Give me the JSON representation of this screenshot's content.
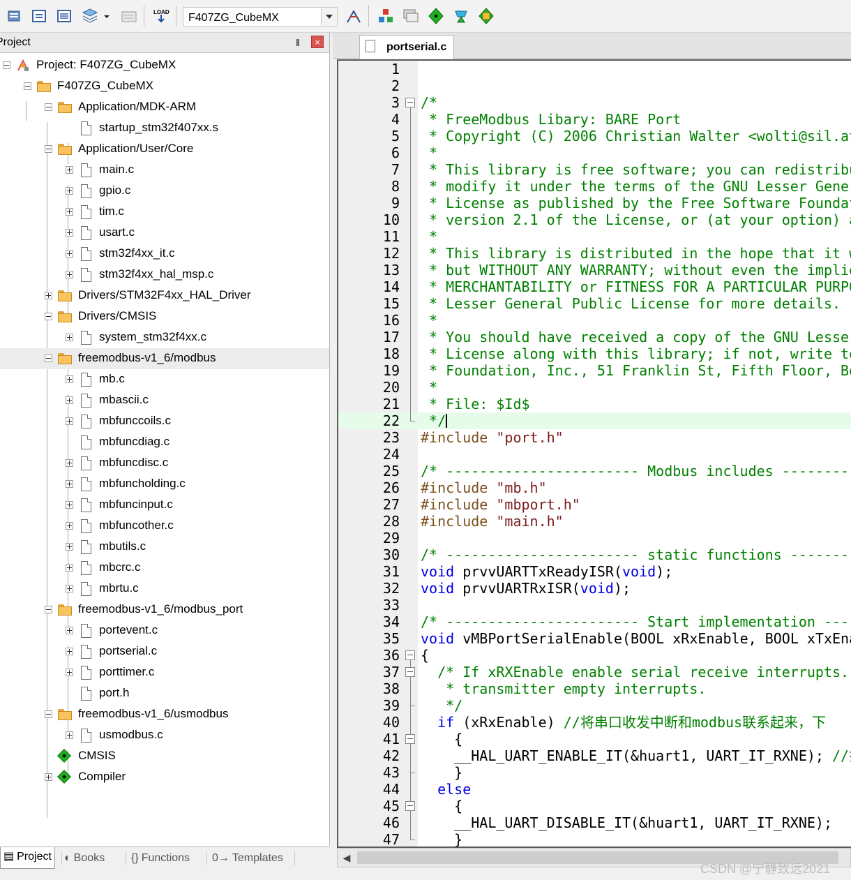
{
  "toolbar": {
    "target_name": "F407ZG_CubeMX",
    "icons": [
      "translate-icon",
      "build-icon",
      "rebuild-icon",
      "batch-build-icon",
      "stop-build-icon",
      "download-load-icon",
      "target-options-icon",
      "manage-project-icon",
      "manage-books-icon",
      "pack-installer-icon",
      "select-packs-icon",
      "run-time-env-icon"
    ]
  },
  "project_panel": {
    "title": "Project",
    "pin_glyph": "‖",
    "close_glyph": "×",
    "tree": [
      {
        "label": "Project: F407ZG_CubeMX"
      },
      {
        "label": "F407ZG_CubeMX"
      },
      {
        "label": "Application/MDK-ARM"
      },
      {
        "label": "startup_stm32f407xx.s"
      },
      {
        "label": "Application/User/Core"
      },
      {
        "label": "main.c"
      },
      {
        "label": "gpio.c"
      },
      {
        "label": "tim.c"
      },
      {
        "label": "usart.c"
      },
      {
        "label": "stm32f4xx_it.c"
      },
      {
        "label": "stm32f4xx_hal_msp.c"
      },
      {
        "label": "Drivers/STM32F4xx_HAL_Driver"
      },
      {
        "label": "Drivers/CMSIS"
      },
      {
        "label": "system_stm32f4xx.c"
      },
      {
        "label": "freemodbus-v1_6/modbus"
      },
      {
        "label": "mb.c"
      },
      {
        "label": "mbascii.c"
      },
      {
        "label": "mbfunccoils.c"
      },
      {
        "label": "mbfuncdiag.c"
      },
      {
        "label": "mbfuncdisc.c"
      },
      {
        "label": "mbfuncholding.c"
      },
      {
        "label": "mbfuncinput.c"
      },
      {
        "label": "mbfuncother.c"
      },
      {
        "label": "mbutils.c"
      },
      {
        "label": "mbcrc.c"
      },
      {
        "label": "mbrtu.c"
      },
      {
        "label": "freemodbus-v1_6/modbus_port"
      },
      {
        "label": "portevent.c"
      },
      {
        "label": "portserial.c"
      },
      {
        "label": "porttimer.c"
      },
      {
        "label": "port.h"
      },
      {
        "label": "freemodbus-v1_6/usmodbus"
      },
      {
        "label": "usmodbus.c"
      },
      {
        "label": "CMSIS"
      },
      {
        "label": "Compiler"
      }
    ],
    "bottom_tabs": [
      {
        "label": "Project",
        "icon": "project-tab-icon",
        "glyph": "▤"
      },
      {
        "label": "Books",
        "icon": "books-tab-icon",
        "glyph": "◐"
      },
      {
        "label": "Functions",
        "icon": "functions-tab-icon",
        "glyph": "{}"
      },
      {
        "label": "Templates",
        "icon": "templates-tab-icon",
        "glyph": "0→"
      }
    ]
  },
  "editor": {
    "active_tab": "portserial.c",
    "cursor_line": 22,
    "lines": [
      {
        "n": "1",
        "segs": []
      },
      {
        "n": "2",
        "segs": []
      },
      {
        "n": "3",
        "segs": [
          {
            "c": "cm",
            "t": "/*"
          }
        ]
      },
      {
        "n": "4",
        "segs": [
          {
            "c": "cm",
            "t": " * FreeModbus Libary: BARE Port"
          }
        ]
      },
      {
        "n": "5",
        "segs": [
          {
            "c": "cm",
            "t": " * Copyright (C) 2006 Christian Walter <wolti@sil.at"
          }
        ]
      },
      {
        "n": "6",
        "segs": [
          {
            "c": "cm",
            "t": " *"
          }
        ]
      },
      {
        "n": "7",
        "segs": [
          {
            "c": "cm",
            "t": " * This library is free software; you can redistribu"
          }
        ]
      },
      {
        "n": "8",
        "segs": [
          {
            "c": "cm",
            "t": " * modify it under the terms of the GNU Lesser Gener"
          }
        ]
      },
      {
        "n": "9",
        "segs": [
          {
            "c": "cm",
            "t": " * License as published by the Free Software Foundat"
          }
        ]
      },
      {
        "n": "10",
        "segs": [
          {
            "c": "cm",
            "t": " * version 2.1 of the License, or (at your option) a"
          }
        ]
      },
      {
        "n": "11",
        "segs": [
          {
            "c": "cm",
            "t": " *"
          }
        ]
      },
      {
        "n": "12",
        "segs": [
          {
            "c": "cm",
            "t": " * This library is distributed in the hope that it w"
          }
        ]
      },
      {
        "n": "13",
        "segs": [
          {
            "c": "cm",
            "t": " * but WITHOUT ANY WARRANTY; without even the implie"
          }
        ]
      },
      {
        "n": "14",
        "segs": [
          {
            "c": "cm",
            "t": " * MERCHANTABILITY or FITNESS FOR A PARTICULAR PURPO"
          }
        ]
      },
      {
        "n": "15",
        "segs": [
          {
            "c": "cm",
            "t": " * Lesser General Public License for more details."
          }
        ]
      },
      {
        "n": "16",
        "segs": [
          {
            "c": "cm",
            "t": " *"
          }
        ]
      },
      {
        "n": "17",
        "segs": [
          {
            "c": "cm",
            "t": " * You should have received a copy of the GNU Lesser"
          }
        ]
      },
      {
        "n": "18",
        "segs": [
          {
            "c": "cm",
            "t": " * License along with this library; if not, write to"
          }
        ]
      },
      {
        "n": "19",
        "segs": [
          {
            "c": "cm",
            "t": " * Foundation, Inc., 51 Franklin St, Fifth Floor, Bo"
          }
        ]
      },
      {
        "n": "20",
        "segs": [
          {
            "c": "cm",
            "t": " *"
          }
        ]
      },
      {
        "n": "21",
        "segs": [
          {
            "c": "cm",
            "t": " * File: $Id$"
          }
        ]
      },
      {
        "n": "22",
        "segs": [
          {
            "c": "cm",
            "t": " */"
          }
        ]
      },
      {
        "n": "23",
        "segs": [
          {
            "c": "pp",
            "t": "#include "
          },
          {
            "c": "st",
            "t": "\"port.h\""
          }
        ]
      },
      {
        "n": "24",
        "segs": []
      },
      {
        "n": "25",
        "segs": [
          {
            "c": "cm",
            "t": "/* ----------------------- Modbus includes ---------"
          }
        ]
      },
      {
        "n": "26",
        "segs": [
          {
            "c": "pp",
            "t": "#include "
          },
          {
            "c": "st",
            "t": "\"mb.h\""
          }
        ]
      },
      {
        "n": "27",
        "segs": [
          {
            "c": "pp",
            "t": "#include "
          },
          {
            "c": "st",
            "t": "\"mbport.h\""
          }
        ]
      },
      {
        "n": "28",
        "segs": [
          {
            "c": "pp",
            "t": "#include "
          },
          {
            "c": "st",
            "t": "\"main.h\""
          }
        ]
      },
      {
        "n": "29",
        "segs": []
      },
      {
        "n": "30",
        "segs": [
          {
            "c": "cm",
            "t": "/* ----------------------- static functions --------"
          }
        ]
      },
      {
        "n": "31",
        "segs": [
          {
            "c": "kw",
            "t": "void"
          },
          {
            "c": "tx",
            "t": " prvvUARTTxReadyISR("
          },
          {
            "c": "kw",
            "t": "void"
          },
          {
            "c": "tx",
            "t": ");"
          }
        ]
      },
      {
        "n": "32",
        "segs": [
          {
            "c": "kw",
            "t": "void"
          },
          {
            "c": "tx",
            "t": " prvvUARTRxISR("
          },
          {
            "c": "kw",
            "t": "void"
          },
          {
            "c": "tx",
            "t": ");"
          }
        ]
      },
      {
        "n": "33",
        "segs": []
      },
      {
        "n": "34",
        "segs": [
          {
            "c": "cm",
            "t": "/* ----------------------- Start implementation ----"
          }
        ]
      },
      {
        "n": "35",
        "segs": [
          {
            "c": "kw",
            "t": "void"
          },
          {
            "c": "tx",
            "t": " vMBPortSerialEnable(BOOL xRxEnable, BOOL xTxEna"
          }
        ]
      },
      {
        "n": "36",
        "segs": [
          {
            "c": "tx",
            "t": "{"
          }
        ]
      },
      {
        "n": "37",
        "segs": [
          {
            "c": "cm",
            "t": "  /* If xRXEnable enable serial receive interrupts."
          }
        ]
      },
      {
        "n": "38",
        "segs": [
          {
            "c": "cm",
            "t": "   * transmitter empty interrupts."
          }
        ]
      },
      {
        "n": "39",
        "segs": [
          {
            "c": "cm",
            "t": "   */"
          }
        ]
      },
      {
        "n": "40",
        "segs": [
          {
            "c": "tx",
            "t": "  "
          },
          {
            "c": "kw",
            "t": "if"
          },
          {
            "c": "tx",
            "t": " (xRxEnable) "
          },
          {
            "c": "cm",
            "t": "//将串口收发中断和modbus联系起来，下"
          }
        ]
      },
      {
        "n": "41",
        "segs": [
          {
            "c": "tx",
            "t": "    {"
          }
        ]
      },
      {
        "n": "42",
        "segs": [
          {
            "c": "tx",
            "t": "    __HAL_UART_ENABLE_IT(&huart1, UART_IT_RXNE); "
          },
          {
            "c": "cm",
            "t": "//打"
          }
        ]
      },
      {
        "n": "43",
        "segs": [
          {
            "c": "tx",
            "t": "    }"
          }
        ]
      },
      {
        "n": "44",
        "segs": [
          {
            "c": "tx",
            "t": "  "
          },
          {
            "c": "kw",
            "t": "else"
          }
        ]
      },
      {
        "n": "45",
        "segs": [
          {
            "c": "tx",
            "t": "    {"
          }
        ]
      },
      {
        "n": "46",
        "segs": [
          {
            "c": "tx",
            "t": "    __HAL_UART_DISABLE_IT(&huart1, UART_IT_RXNE);"
          }
        ]
      },
      {
        "n": "47",
        "segs": [
          {
            "c": "tx",
            "t": "    }"
          }
        ]
      }
    ]
  },
  "scrollbar": {
    "left_arrow_glyph": "◀"
  },
  "watermark": "CSDN @宁静致远2021"
}
